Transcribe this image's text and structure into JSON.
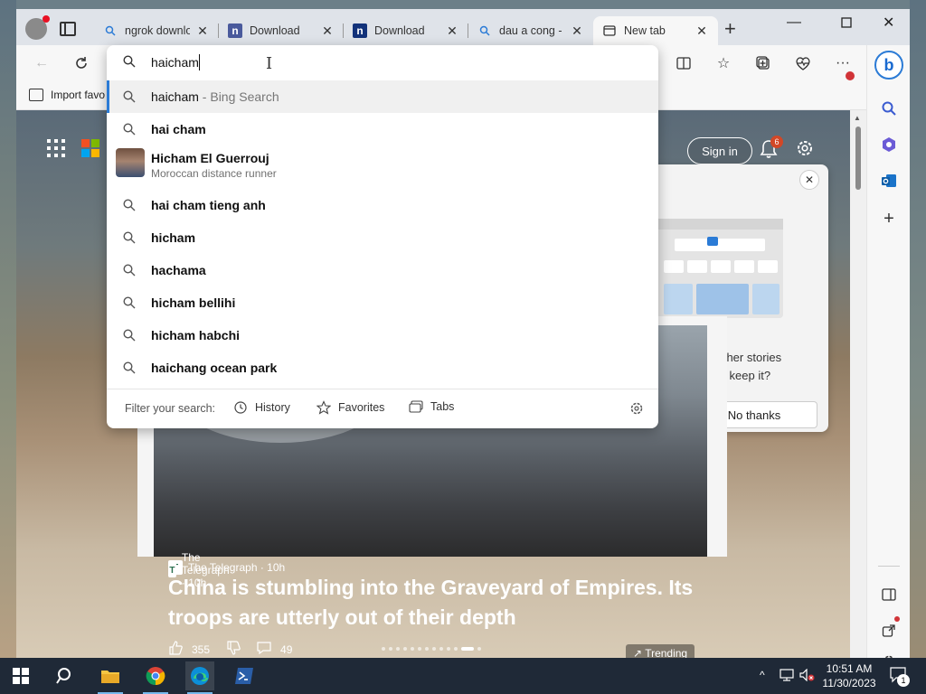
{
  "tabs": [
    {
      "title": "ngrok downlo",
      "favicon": "search-icon"
    },
    {
      "title": "Download",
      "favicon": "n-logo-icon"
    },
    {
      "title": "Download",
      "favicon": "n-logo-icon"
    },
    {
      "title": "dau a cong -",
      "favicon": "search-icon"
    },
    {
      "title": "New tab",
      "favicon": "new-tab-icon",
      "active": true
    }
  ],
  "favorites_bar": {
    "import_label": "Import favo"
  },
  "address_bar": {
    "value": "haicham"
  },
  "suggestions": [
    {
      "text": "haicham",
      "hint": " - Bing Search",
      "highlighted": true
    },
    {
      "text": "hai cham"
    },
    {
      "text": "Hicham El Guerrouj",
      "subtitle": "Moroccan distance runner",
      "type": "entity"
    },
    {
      "text": "hai cham tieng anh"
    },
    {
      "text": "hicham"
    },
    {
      "text": "hachama"
    },
    {
      "text": "hicham bellihi"
    },
    {
      "text": "hicham habchi"
    },
    {
      "text": "haichang ocean park"
    }
  ],
  "filter": {
    "label": "Filter your search:",
    "history": "History",
    "favorites": "Favorites",
    "tabs": "Tabs"
  },
  "newtab": {
    "signin_label": "Sign in",
    "notification_count": "6"
  },
  "popup": {
    "line1": "?",
    "line2": "es news and other stories",
    "line3": "erests. Want to keep it?",
    "no_label": "No thanks"
  },
  "feed": {
    "source": "The Telegraph · 10h",
    "headline": "China is stumbling into the Graveyard of Empires. Its troops are utterly out of their depth",
    "likes": "355",
    "comments": "49",
    "trending_label": "Trending"
  },
  "taskbar": {
    "time": "10:51 AM",
    "date": "11/30/2023",
    "notification_count": "1"
  },
  "colors": {
    "accent": "#2b7bd6",
    "taskbar": "#1f2937"
  }
}
